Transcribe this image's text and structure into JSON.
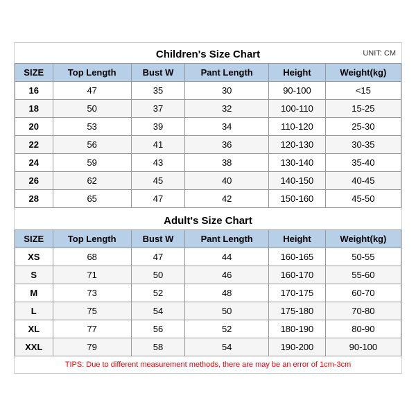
{
  "children_title": "Children's Size Chart",
  "adults_title": "Adult's Size Chart",
  "unit": "UNIT: CM",
  "tips": "TIPS: Due to different measurement methods, there are may be an error of 1cm-3cm",
  "columns": [
    "SIZE",
    "Top Length",
    "Bust W",
    "Pant Length",
    "Height",
    "Weight(kg)"
  ],
  "children_rows": [
    [
      "16",
      "47",
      "35",
      "30",
      "90-100",
      "<15"
    ],
    [
      "18",
      "50",
      "37",
      "32",
      "100-110",
      "15-25"
    ],
    [
      "20",
      "53",
      "39",
      "34",
      "110-120",
      "25-30"
    ],
    [
      "22",
      "56",
      "41",
      "36",
      "120-130",
      "30-35"
    ],
    [
      "24",
      "59",
      "43",
      "38",
      "130-140",
      "35-40"
    ],
    [
      "26",
      "62",
      "45",
      "40",
      "140-150",
      "40-45"
    ],
    [
      "28",
      "65",
      "47",
      "42",
      "150-160",
      "45-50"
    ]
  ],
  "adult_rows": [
    [
      "XS",
      "68",
      "47",
      "44",
      "160-165",
      "50-55"
    ],
    [
      "S",
      "71",
      "50",
      "46",
      "160-170",
      "55-60"
    ],
    [
      "M",
      "73",
      "52",
      "48",
      "170-175",
      "60-70"
    ],
    [
      "L",
      "75",
      "54",
      "50",
      "175-180",
      "70-80"
    ],
    [
      "XL",
      "77",
      "56",
      "52",
      "180-190",
      "80-90"
    ],
    [
      "XXL",
      "79",
      "58",
      "54",
      "190-200",
      "90-100"
    ]
  ]
}
